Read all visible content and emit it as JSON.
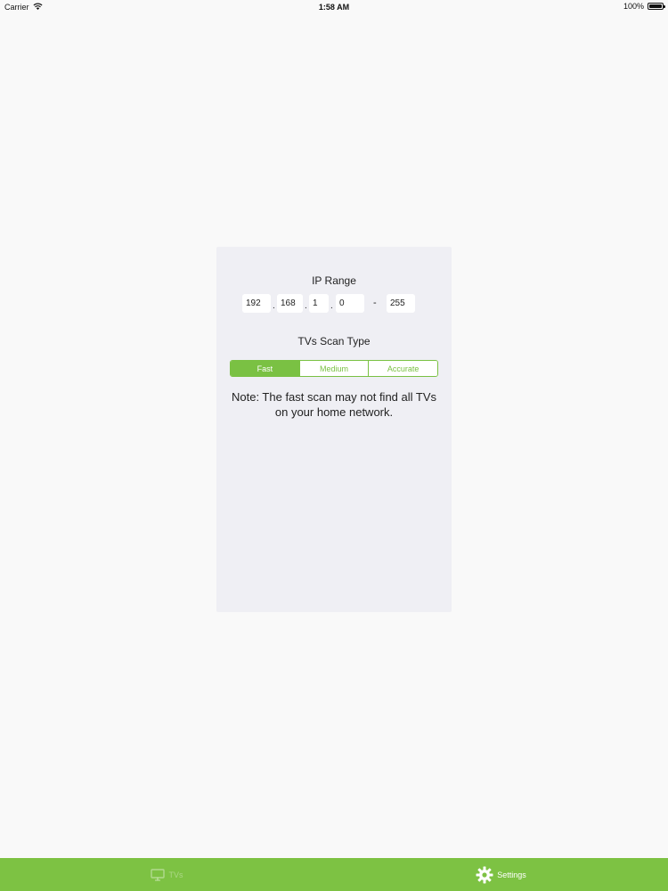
{
  "status_bar": {
    "carrier": "Carrier",
    "time": "1:58 AM",
    "battery": "100%"
  },
  "settings": {
    "ip_range_title": "IP Range",
    "ip": {
      "octet1": "192",
      "octet2": "168",
      "octet3": "1",
      "octet4": "0",
      "range_end": "255"
    },
    "ip_separator": ".",
    "range_separator": "-",
    "scan_type_title": "TVs Scan Type",
    "scan_types": [
      "Fast",
      "Medium",
      "Accurate"
    ],
    "selected_scan_type": "Fast",
    "note": "Note: The fast scan may not find all TVs on your home network."
  },
  "tab_bar": {
    "tabs": [
      {
        "label": "TVs",
        "icon": "tv-icon",
        "selected": false
      },
      {
        "label": "Settings",
        "icon": "gear-icon",
        "selected": true
      }
    ]
  },
  "colors": {
    "accent": "#7ac143",
    "panel_bg": "#efeff4",
    "page_bg": "#f9f9f9"
  }
}
